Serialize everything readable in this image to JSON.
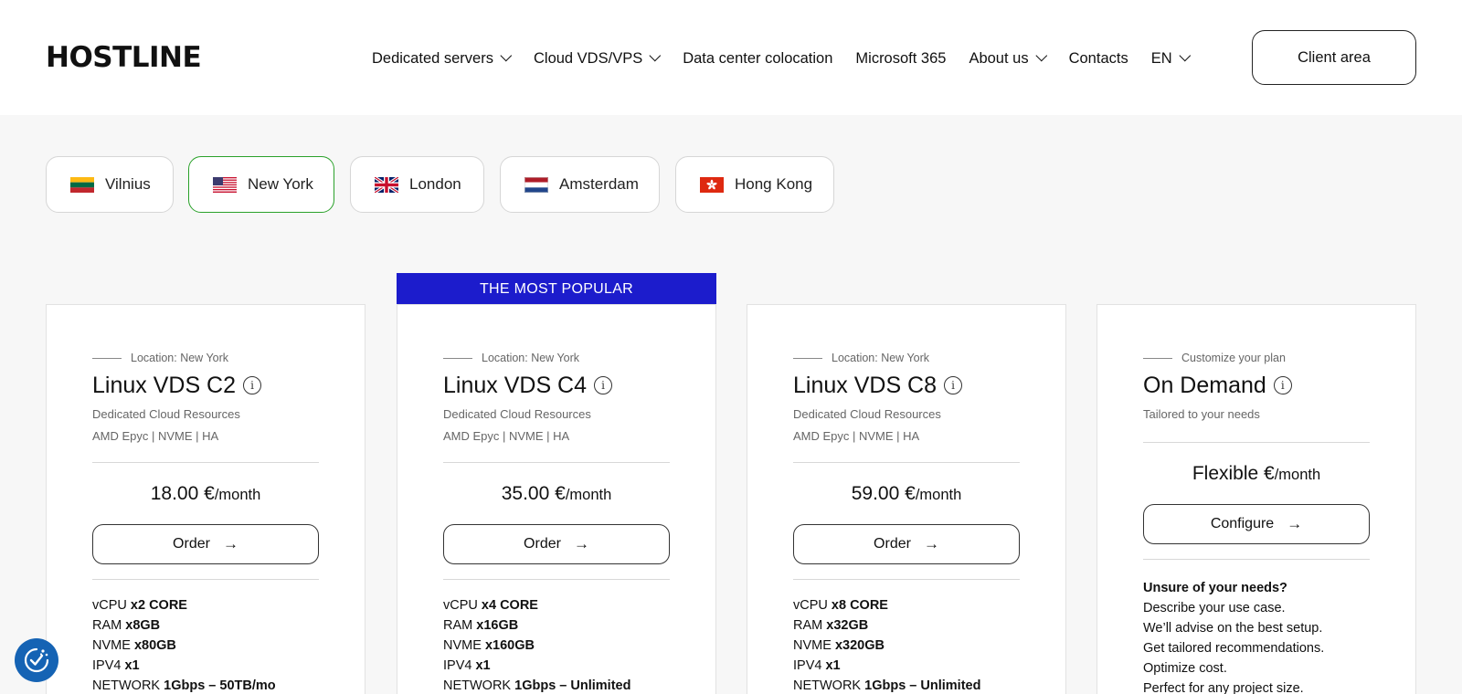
{
  "brand": {
    "logo": "HOSTLINE"
  },
  "nav": {
    "items": [
      {
        "label": "Dedicated servers",
        "dropdown": true
      },
      {
        "label": "Cloud VDS/VPS",
        "dropdown": true
      },
      {
        "label": "Data center colocation",
        "dropdown": false
      },
      {
        "label": "Microsoft 365",
        "dropdown": false
      },
      {
        "label": "About us",
        "dropdown": true
      },
      {
        "label": "Contacts",
        "dropdown": false
      },
      {
        "label": "EN",
        "dropdown": true
      }
    ],
    "client_area": "Client area"
  },
  "locations": {
    "selected": "New York",
    "tabs": [
      {
        "label": "Vilnius",
        "flag": "lithuania-flag-icon"
      },
      {
        "label": "New York",
        "flag": "usa-flag-icon"
      },
      {
        "label": "London",
        "flag": "uk-flag-icon"
      },
      {
        "label": "Amsterdam",
        "flag": "netherlands-flag-icon"
      },
      {
        "label": "Hong Kong",
        "flag": "hong-kong-flag-icon"
      }
    ]
  },
  "popular_badge": "THE MOST POPULAR",
  "plans": [
    {
      "location": "Location: New York",
      "title": "Linux VDS C2",
      "subtitle": "Dedicated Cloud Resources",
      "features": "AMD Epyc | NVME | HA",
      "price": "18.00 €",
      "period": "/month",
      "button": "Order",
      "specs": {
        "vcpu_label": "vCPU",
        "vcpu": "x2 CORE",
        "ram_label": "RAM",
        "ram": "x8GB",
        "nvme_label": "NVME",
        "nvme": "x80GB",
        "ipv4_label": "IPV4",
        "ipv4": "x1",
        "network_label": "NETWORK",
        "network": "1Gbps – 50TB/mo"
      }
    },
    {
      "location": "Location: New York",
      "title": "Linux VDS C4",
      "subtitle": "Dedicated Cloud Resources",
      "features": "AMD Epyc | NVME | HA",
      "price": "35.00 €",
      "period": "/month",
      "button": "Order",
      "specs": {
        "vcpu_label": "vCPU",
        "vcpu": "x4 CORE",
        "ram_label": "RAM",
        "ram": "x16GB",
        "nvme_label": "NVME",
        "nvme": "x160GB",
        "ipv4_label": "IPV4",
        "ipv4": "x1",
        "network_label": "NETWORK",
        "network": "1Gbps – Unlimited"
      }
    },
    {
      "location": "Location: New York",
      "title": "Linux VDS C8",
      "subtitle": "Dedicated Cloud Resources",
      "features": "AMD Epyc | NVME | HA",
      "price": "59.00 €",
      "period": "/month",
      "button": "Order",
      "specs": {
        "vcpu_label": "vCPU",
        "vcpu": "x8 CORE",
        "ram_label": "RAM",
        "ram": "x32GB",
        "nvme_label": "NVME",
        "nvme": "x320GB",
        "ipv4_label": "IPV4",
        "ipv4": "x1",
        "network_label": "NETWORK",
        "network": "1Gbps – Unlimited"
      }
    }
  ],
  "on_demand": {
    "eyebrow": "Customize your plan",
    "title": "On Demand",
    "subtitle": "Tailored to your needs",
    "price": "Flexible €",
    "period": "/month",
    "button": "Configure",
    "heading": "Unsure of your needs?",
    "lines": [
      "Describe your use case.",
      "We’ll advise on the best setup.",
      "Get tailored recommendations.",
      "Optimize cost.",
      "Perfect for any project size."
    ]
  },
  "colors": {
    "accent_popular": "#1c1ccc",
    "selected_tab_border": "#2aa12a",
    "cookie_badge": "#1563b4"
  }
}
